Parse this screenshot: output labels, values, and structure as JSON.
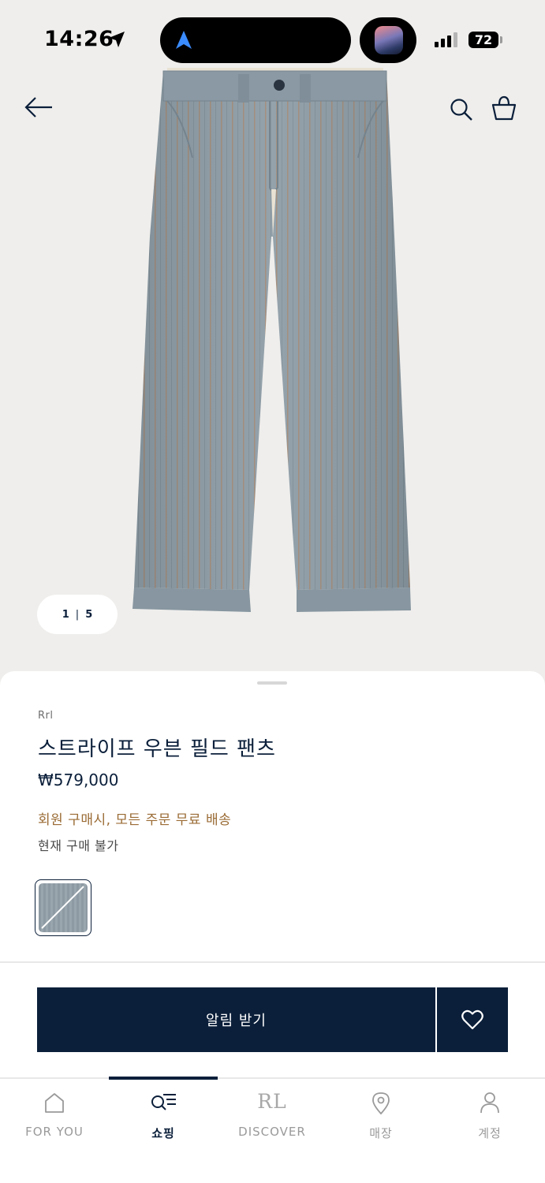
{
  "status_bar": {
    "time": "14:26",
    "battery": "72"
  },
  "gallery": {
    "current": "1",
    "separator": "|",
    "total": "5"
  },
  "product": {
    "brand": "Rrl",
    "title": "스트라이프 우븐 필드 팬츠",
    "price": "₩579,000",
    "promo": "회원 구매시, 모든 주문 무료 배송",
    "availability": "현재 구매 불가"
  },
  "actions": {
    "notify_label": "알림 받기"
  },
  "tabs": [
    {
      "label": "FOR YOU",
      "icon": "home-icon"
    },
    {
      "label": "쇼핑",
      "icon": "shopping-search-icon"
    },
    {
      "label": "DISCOVER",
      "logo": "RL"
    },
    {
      "label": "매장",
      "icon": "location-pin-icon"
    },
    {
      "label": "계정",
      "icon": "person-icon"
    }
  ],
  "colors": {
    "navy": "#0b1f3a",
    "promo": "#9a6b34",
    "hero_bg": "#efeeec"
  }
}
